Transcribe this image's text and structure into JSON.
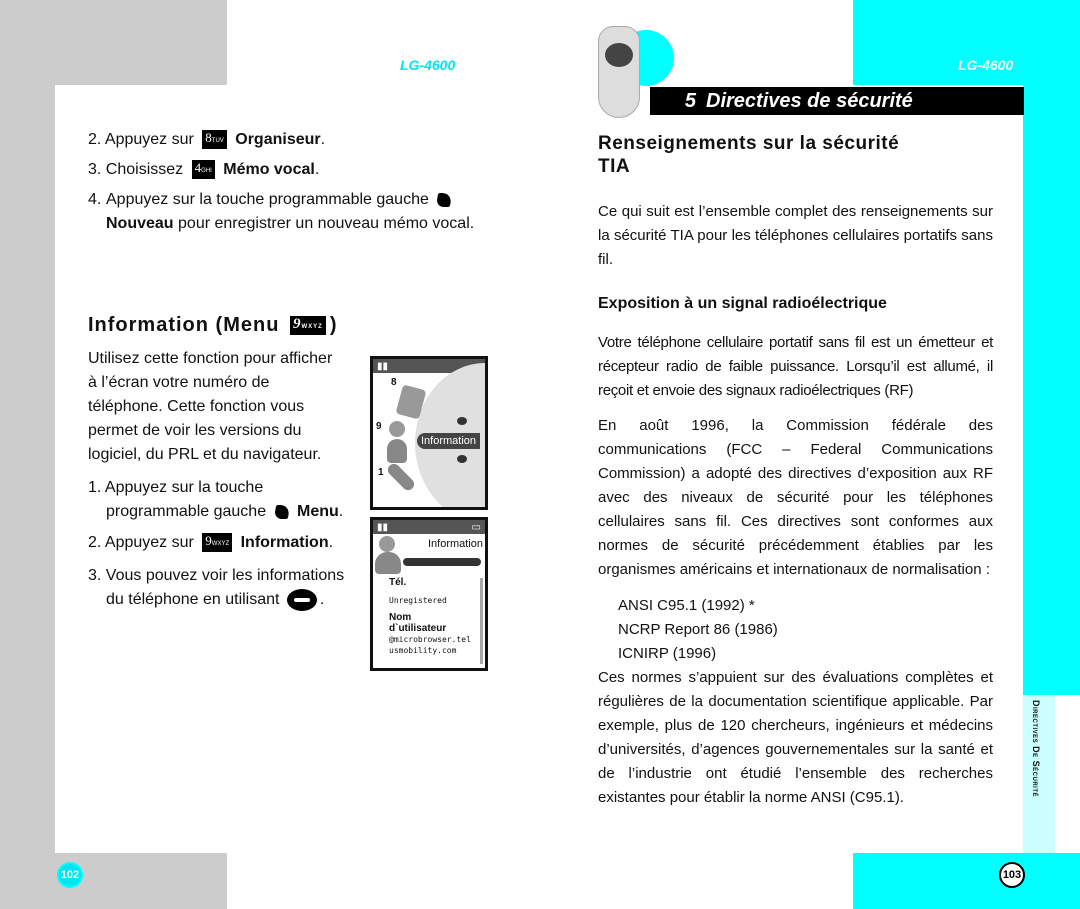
{
  "header": {
    "model_left": "LG-4600",
    "model_right": "LG-4600",
    "chapter_number": "5",
    "chapter_title": "Directives de sécurité"
  },
  "colors": {
    "accent": "#00ffff",
    "gray": "#cccccc",
    "light_accent": "#ccffff"
  },
  "left_page": {
    "steps_top": [
      {
        "num": "2.",
        "text": "Appuyez sur",
        "key": "8",
        "key_sub": "TUV",
        "bold": "Organiseur",
        "end": "."
      },
      {
        "num": "3.",
        "text": "Choisissez",
        "key": "4",
        "key_sub": "GHI",
        "bold": "Mémo vocal",
        "end": "."
      },
      {
        "num": "4.",
        "text": "Appuyez sur la touche programmable gauche",
        "icon": "left-softkey-icon",
        "bold": "Nouveau",
        "rest": "pour enregistrer un nouveau mémo vocal."
      }
    ],
    "section_title": "Information (Menu",
    "section_key": "9",
    "section_key_sub": "WXYZ",
    "section_close": ")",
    "intro": "Utilisez cette fonction pour afficher à l’écran votre numéro de téléphone. Cette fonction vous permet de voir les versions du logiciel, du PRL et du navigateur.",
    "intro_lines": [
      "Utilisez cette fonction pour afficher",
      "à l’écran votre numéro de",
      "téléphone. Cette fonction vous",
      "permet de voir les versions du",
      "logiciel, du PRL et du navigateur."
    ],
    "steps_bottom": [
      {
        "num": "1.",
        "line1": "Appuyez sur la touche",
        "line2": "programmable gauche",
        "bold": "Menu",
        "end": "."
      },
      {
        "num": "2.",
        "text": "Appuyez sur",
        "key": "9",
        "key_sub": "WXYZ",
        "bold": "Information",
        "end": "."
      },
      {
        "num": "3.",
        "line1": "Vous pouvez voir les informations",
        "line2": "du téléphone en utilisant",
        "end": "."
      }
    ],
    "screen1": {
      "items": [
        "8",
        "9",
        "1"
      ],
      "label": "Information"
    },
    "screen2": {
      "title": "Information",
      "fields": [
        {
          "label": "Tél.",
          "value": "Unregistered"
        },
        {
          "label": "Nom d`utilisateur",
          "value": "@microbrowser.tel usmobility.com"
        }
      ],
      "label_nom": "Nom",
      "label_user": "d`utilisateur",
      "value_1": "@microbrowser.tel",
      "value_2": "usmobility.com"
    },
    "page_number": "102"
  },
  "right_page": {
    "heading_line1": "Renseignements sur la sécurité",
    "heading_line2": "TIA",
    "intro": "Ce qui suit est l’ensemble complet des renseignements sur la sécurité TIA pour les téléphones cellulaires portatifs sans fil.",
    "subheading": "Exposition à un signal radioélectrique",
    "para1": "Votre téléphone cellulaire portatif sans fil est un émetteur et récepteur radio de faible puissance. Lorsqu’il est allumé, il reçoit et envoie des signaux radioélectriques (RF)",
    "para2": "En août 1996, la Commission fédérale des communications (FCC – Federal Communications Commission) a adopté des directives d’exposition aux RF avec des niveaux de sécurité pour les téléphones cellulaires sans fil. Ces directives sont conformes aux normes de sécurité précédemment établies par les organismes américains et internationaux de normalisation :",
    "standards": [
      "ANSI C95.1 (1992) *",
      "NCRP Report 86 (1986)",
      "ICNIRP (1996)"
    ],
    "para3": "Ces normes s’appuient sur des évaluations complètes et régulières de la documentation scientifique applicable. Par exemple, plus de 120 chercheurs, ingénieurs et médecins d’universités, d’agences gouvernementales sur la santé et de l’industrie ont étudié l’ensemble des recherches existantes pour établir la norme ANSI (C95.1).",
    "side_label": "Directives De Sécurité",
    "page_number": "103"
  }
}
